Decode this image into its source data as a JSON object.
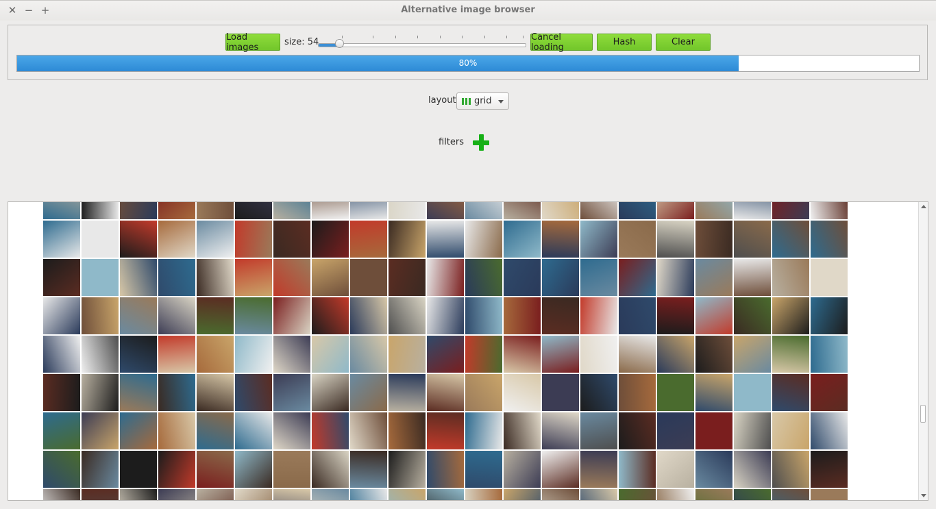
{
  "window": {
    "title": "Alternative image browser",
    "close_glyph": "✕",
    "minimize_glyph": "−",
    "maximize_glyph": "+"
  },
  "toolbar": {
    "load_label": "Load images",
    "size_label": "size: 54",
    "size_value": 54,
    "cancel_label": "Cancel loading",
    "hash_label": "Hash",
    "clear_label": "Clear",
    "accent": "#7ccf32"
  },
  "progress": {
    "value": 0.8,
    "text": "80%",
    "color": "#3498db"
  },
  "layout": {
    "label": "layout",
    "selected": "grid",
    "icon": "grid-icon"
  },
  "filters": {
    "label": "filters",
    "add_icon": "plus-icon"
  },
  "gallery": {
    "columns": 21,
    "rows": 8,
    "palette": [
      "#3a2a22",
      "#6e4e3a",
      "#2f4a6b",
      "#8fb9c9",
      "#d9d4c4",
      "#1c1c1c",
      "#a66a3c",
      "#5b2c22",
      "#c9a56a",
      "#7a1e1e",
      "#e8e8e8",
      "#2e6b8f",
      "#4a6b2e",
      "#b8b0a0",
      "#d8c8a8",
      "#9a7a5a",
      "#3c3c54",
      "#c23a2a",
      "#e0d8c8",
      "#4e4e4e",
      "#8a6a4a",
      "#2a3a5a",
      "#f0f0f0",
      "#6a8aa0"
    ]
  }
}
